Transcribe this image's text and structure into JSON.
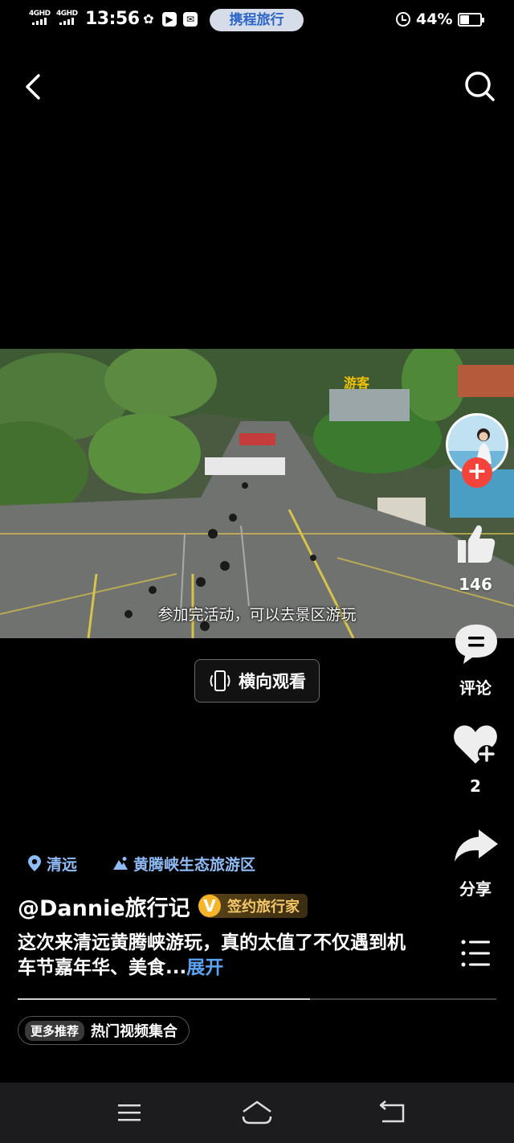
{
  "status_bar": {
    "signal_1": "4GHD",
    "signal_2": "4GHD",
    "time": "13:56",
    "trip_app": "携程旅行",
    "battery": "44%",
    "battery_level": 0.44
  },
  "video": {
    "sign_text": "游客",
    "subtitle": "参加完活动，可以去景区游玩",
    "landscape_label": "横向观看"
  },
  "rail": {
    "like_count": "146",
    "comment_label": "评论",
    "favorite_count": "2",
    "share_label": "分享",
    "follow_symbol": "+"
  },
  "info": {
    "location_city": "清远",
    "location_poi": "黄腾峡生态旅游区",
    "author": "@Dannie旅行记",
    "badge_icon": "V",
    "badge_label": "签约旅行家",
    "description": "这次来清远黄腾峡游玩，真的太值了不仅遇到机车节嘉年华、美食...",
    "expand_label": "展开",
    "progress": 0.61,
    "reco_tag": "更多推荐",
    "reco_text": "热门视频集合"
  },
  "colors": {
    "link_blue": "#5aa3f5",
    "location_blue": "#8ebcf7",
    "follow_red": "#f4433a",
    "badge_gold": "#f5b52a"
  }
}
